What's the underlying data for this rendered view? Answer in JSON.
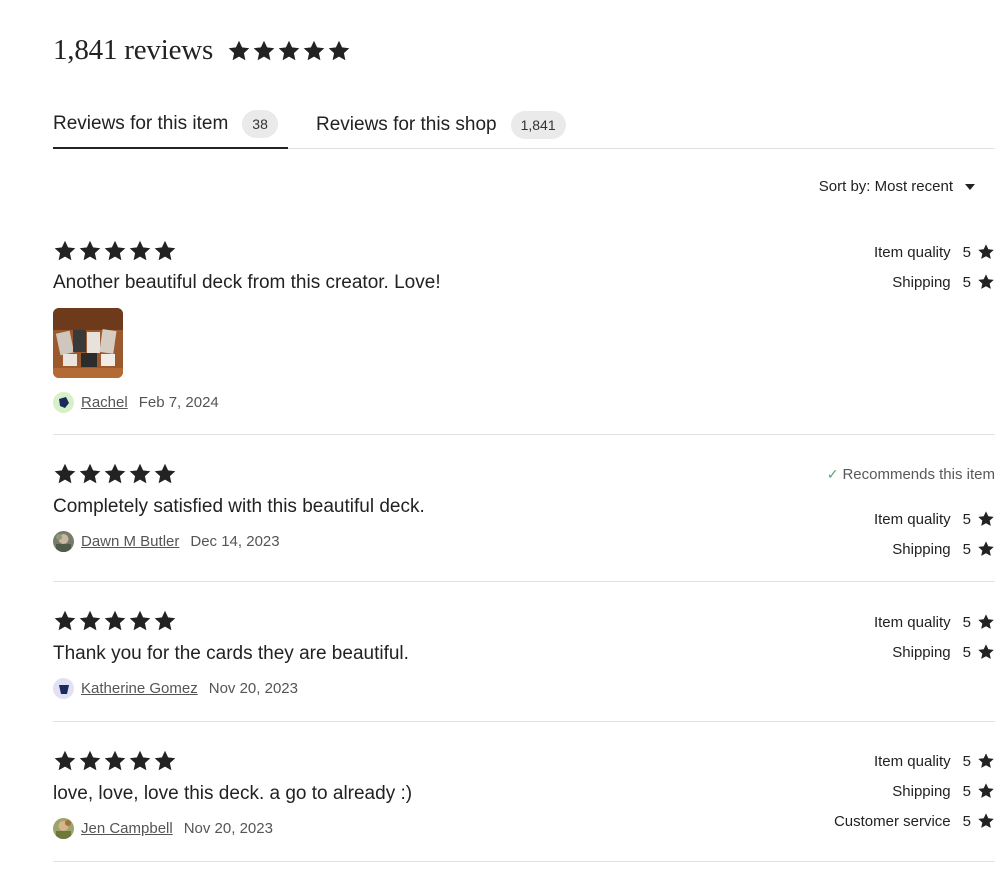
{
  "header": {
    "count_title": "1,841 reviews",
    "stars": 5
  },
  "tabs": [
    {
      "label": "Reviews for this item",
      "badge": "38",
      "active": true
    },
    {
      "label": "Reviews for this shop",
      "badge": "1,841",
      "active": false
    }
  ],
  "sort": {
    "label": "Sort by: Most recent"
  },
  "colors": {
    "text": "#222222",
    "muted": "#555555",
    "check": "#5aa76b",
    "badge_bg": "#eaeaea",
    "divider": "#e1e1e1"
  },
  "reviews": [
    {
      "stars": 5,
      "text": "Another beautiful deck from this creator. Love!",
      "has_photo": true,
      "reviewer": "Rachel",
      "date": "Feb 7, 2024",
      "recommends": "",
      "ratings": [
        {
          "label": "Item quality",
          "value": "5"
        },
        {
          "label": "Shipping",
          "value": "5"
        }
      ]
    },
    {
      "stars": 5,
      "text": "Completely satisfied with this beautiful deck.",
      "has_photo": false,
      "reviewer": "Dawn M Butler",
      "date": "Dec 14, 2023",
      "recommends": "Recommends this item",
      "ratings": [
        {
          "label": "Item quality",
          "value": "5"
        },
        {
          "label": "Shipping",
          "value": "5"
        }
      ]
    },
    {
      "stars": 5,
      "text": "Thank you for the cards they are beautiful.",
      "has_photo": false,
      "reviewer": "Katherine Gomez",
      "date": "Nov 20, 2023",
      "recommends": "",
      "ratings": [
        {
          "label": "Item quality",
          "value": "5"
        },
        {
          "label": "Shipping",
          "value": "5"
        }
      ]
    },
    {
      "stars": 5,
      "text": "love, love, love this deck. a go to already :)",
      "has_photo": false,
      "reviewer": "Jen Campbell",
      "date": "Nov 20, 2023",
      "recommends": "",
      "ratings": [
        {
          "label": "Item quality",
          "value": "5"
        },
        {
          "label": "Shipping",
          "value": "5"
        },
        {
          "label": "Customer service",
          "value": "5"
        }
      ]
    }
  ]
}
